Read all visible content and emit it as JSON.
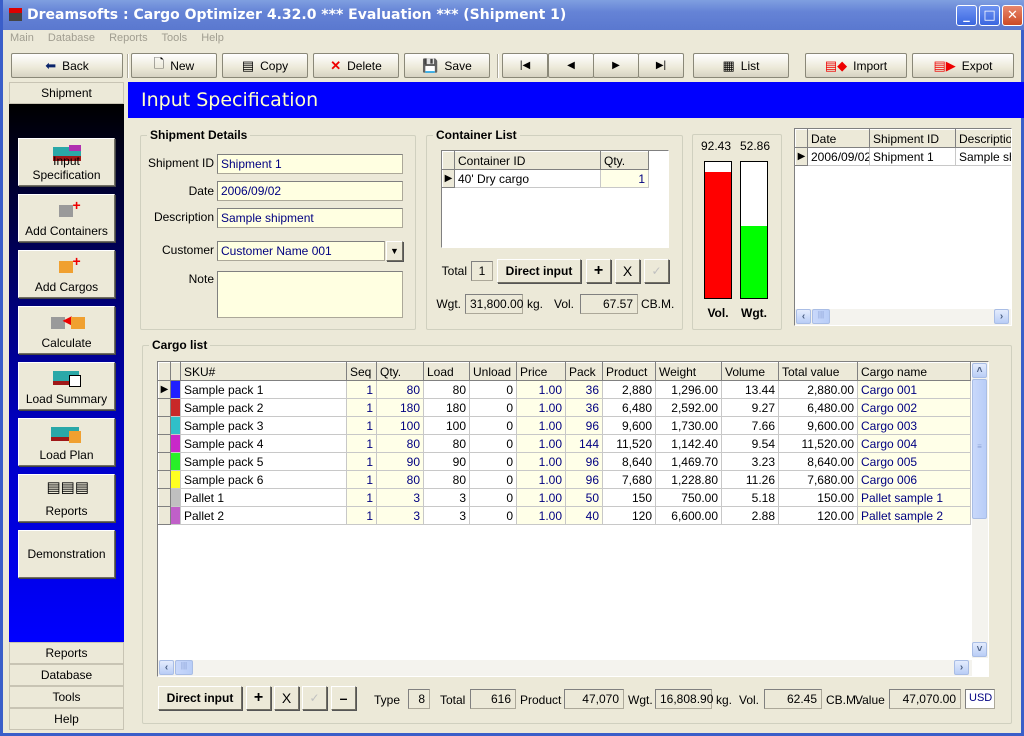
{
  "window": {
    "title": "Dreamsofts : Cargo Optimizer 4.32.0 *** Evaluation *** (Shipment 1)",
    "controls": [
      "minimize",
      "maximize",
      "close"
    ]
  },
  "menu": [
    "Main",
    "Database",
    "Reports",
    "Tools",
    "Help"
  ],
  "toolbar": {
    "back": "Back",
    "new": "New",
    "copy": "Copy",
    "delete": "Delete",
    "save": "Save",
    "first": "first-record",
    "prev": "previous-record",
    "next": "next-record",
    "last": "last-record",
    "list": "List",
    "import": "Import",
    "export": "Expot"
  },
  "sidebar": {
    "top_tab": "Shipment",
    "buttons": [
      {
        "label": "Input Specification",
        "icon": "container-icon"
      },
      {
        "label": "Add Containers",
        "icon": "add-container-icon"
      },
      {
        "label": "Add Cargos",
        "icon": "add-cargo-icon"
      },
      {
        "label": "Calculate",
        "icon": "calculate-icon"
      },
      {
        "label": "Load Summary",
        "icon": "load-summary-icon"
      },
      {
        "label": "Load Plan",
        "icon": "load-plan-icon"
      },
      {
        "label": "Reports",
        "icon": "reports-icon"
      },
      {
        "label": "Demonstration",
        "icon": ""
      }
    ],
    "bottom_tabs": [
      "Reports",
      "Database",
      "Tools",
      "Help"
    ]
  },
  "header": {
    "title": "Input Specification"
  },
  "shipment_details": {
    "legend": "Shipment Details",
    "shipment_id_label": "Shipment ID",
    "shipment_id": "Shipment 1",
    "date_label": "Date",
    "date": "2006/09/02",
    "description_label": "Description",
    "description": "Sample shipment",
    "customer_label": "Customer",
    "customer": "Customer Name 001",
    "note_label": "Note",
    "note": ""
  },
  "container_list": {
    "legend": "Container List",
    "columns": [
      "Container ID",
      "Qty."
    ],
    "rows": [
      {
        "id": "40' Dry cargo",
        "qty": "1"
      }
    ],
    "total_label": "Total",
    "total": "1",
    "direct_input": "Direct input",
    "add": "+",
    "remove": "X",
    "confirm": "✓",
    "wgt_label": "Wgt.",
    "wgt": "31,800.00",
    "wgt_unit": "kg.",
    "vol_label": "Vol.",
    "vol": "67.57",
    "vol_unit": "CB.M."
  },
  "utilization": {
    "vol_percent": 92.43,
    "wgt_percent": 52.86,
    "vol_text": "92.43",
    "wgt_text": "52.86",
    "vol_label": "Vol.",
    "wgt_label": "Wgt.",
    "vol_color": "#ff0000",
    "wgt_color": "#00ff00"
  },
  "shipment_grid": {
    "columns": [
      "Date",
      "Shipment ID",
      "Description"
    ],
    "rows": [
      {
        "date": "2006/09/02",
        "id": "Shipment 1",
        "description": "Sample ship"
      }
    ]
  },
  "cargo_list": {
    "legend": "Cargo list",
    "columns": [
      "SKU#",
      "Seq",
      "Qty.",
      "Load",
      "Unload",
      "Price",
      "Pack",
      "Product",
      "Weight",
      "Volume",
      "Total value",
      "Cargo name"
    ],
    "rows": [
      {
        "color": "#1f1fff",
        "sku": "Sample pack 1",
        "seq": "1",
        "qty": "80",
        "load": "80",
        "unload": "0",
        "price": "1.00",
        "pack": "36",
        "product": "2,880",
        "weight": "1,296.00",
        "volume": "13.44",
        "total": "2,880.00",
        "name": "Cargo 001"
      },
      {
        "color": "#c82828",
        "sku": "Sample pack 2",
        "seq": "1",
        "qty": "180",
        "load": "180",
        "unload": "0",
        "price": "1.00",
        "pack": "36",
        "product": "6,480",
        "weight": "2,592.00",
        "volume": "9.27",
        "total": "6,480.00",
        "name": "Cargo 002"
      },
      {
        "color": "#30c0c8",
        "sku": "Sample pack 3",
        "seq": "1",
        "qty": "100",
        "load": "100",
        "unload": "0",
        "price": "1.00",
        "pack": "96",
        "product": "9,600",
        "weight": "1,730.00",
        "volume": "7.66",
        "total": "9,600.00",
        "name": "Cargo 003"
      },
      {
        "color": "#c828c8",
        "sku": "Sample pack 4",
        "seq": "1",
        "qty": "80",
        "load": "80",
        "unload": "0",
        "price": "1.00",
        "pack": "144",
        "product": "11,520",
        "weight": "1,142.40",
        "volume": "9.54",
        "total": "11,520.00",
        "name": "Cargo 004"
      },
      {
        "color": "#28f028",
        "sku": "Sample pack 5",
        "seq": "1",
        "qty": "90",
        "load": "90",
        "unload": "0",
        "price": "1.00",
        "pack": "96",
        "product": "8,640",
        "weight": "1,469.70",
        "volume": "3.23",
        "total": "8,640.00",
        "name": "Cargo 005"
      },
      {
        "color": "#ffff20",
        "sku": "Sample pack 6",
        "seq": "1",
        "qty": "80",
        "load": "80",
        "unload": "0",
        "price": "1.00",
        "pack": "96",
        "product": "7,680",
        "weight": "1,228.80",
        "volume": "11.26",
        "total": "7,680.00",
        "name": "Cargo 006"
      },
      {
        "color": "#c0c0c0",
        "sku": "Pallet 1",
        "seq": "1",
        "qty": "3",
        "load": "3",
        "unload": "0",
        "price": "1.00",
        "pack": "50",
        "product": "150",
        "weight": "750.00",
        "volume": "5.18",
        "total": "150.00",
        "name": "Pallet sample 1"
      },
      {
        "color": "#c060c8",
        "sku": "Pallet 2",
        "seq": "1",
        "qty": "3",
        "load": "3",
        "unload": "0",
        "price": "1.00",
        "pack": "40",
        "product": "120",
        "weight": "6,600.00",
        "volume": "2.88",
        "total": "120.00",
        "name": "Pallet sample 2"
      }
    ]
  },
  "footer": {
    "direct_input": "Direct input",
    "add": "+",
    "remove": "X",
    "confirm": "✓",
    "minus": "–",
    "type_label": "Type",
    "type": "8",
    "total_label": "Total",
    "total": "616",
    "product_label": "Product",
    "product": "47,070",
    "wgt_label": "Wgt.",
    "wgt": "16,808.90",
    "wgt_unit": "kg.",
    "vol_label": "Vol.",
    "vol": "62.45",
    "vol_unit": "CB.M.",
    "value_label": "Value",
    "value": "47,070.00",
    "currency": "USD"
  }
}
